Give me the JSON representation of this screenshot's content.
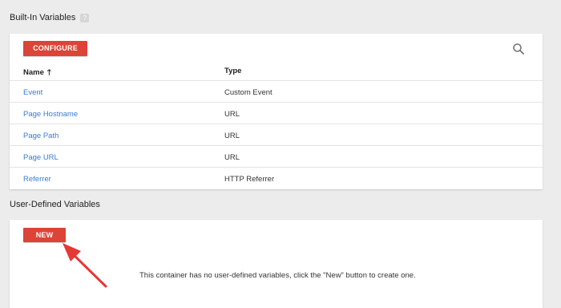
{
  "builtin": {
    "title": "Built-In Variables",
    "help_glyph": "?",
    "configure_label": "CONFIGURE",
    "columns": {
      "name": "Name",
      "sort_glyph": "🡑",
      "type": "Type"
    },
    "rows": [
      {
        "name": "Event",
        "type": "Custom Event"
      },
      {
        "name": "Page Hostname",
        "type": "URL"
      },
      {
        "name": "Page Path",
        "type": "URL"
      },
      {
        "name": "Page URL",
        "type": "URL"
      },
      {
        "name": "Referrer",
        "type": "HTTP Referrer"
      }
    ]
  },
  "user_defined": {
    "title": "User-Defined Variables",
    "new_label": "NEW",
    "empty_message": "This container has no user-defined variables, click the \"New\" button to create one."
  },
  "colors": {
    "accent_red": "#db4437",
    "link_blue": "#3a7bd5",
    "annotation_arrow": "#e53935"
  },
  "icons": {
    "search": "search-icon",
    "help": "help-icon",
    "sort": "arrow-up-icon",
    "annotation": "pointer-arrow-icon"
  }
}
